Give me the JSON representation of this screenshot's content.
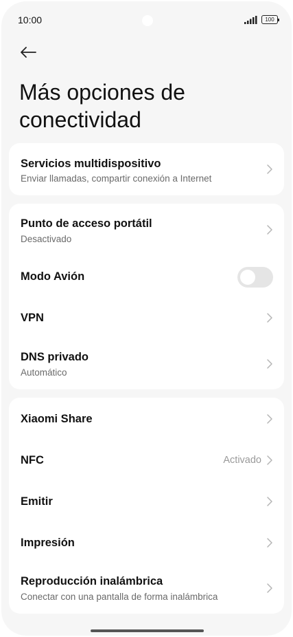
{
  "status_bar": {
    "time": "10:00",
    "battery": "100",
    "icons": [
      "signal-icon",
      "battery-icon"
    ]
  },
  "header": {
    "back_icon": "arrow-left-icon",
    "title": "Más opciones de conectividad"
  },
  "group1": {
    "items": [
      {
        "title": "Servicios multidispositivo",
        "subtitle": "Enviar llamadas, compartir conexión a Internet"
      }
    ]
  },
  "group2": {
    "items": [
      {
        "title": "Punto de acceso portátil",
        "subtitle": "Desactivado"
      },
      {
        "title": "Modo Avión",
        "toggle_on": false
      },
      {
        "title": "VPN"
      },
      {
        "title": "DNS privado",
        "subtitle": "Automático"
      }
    ]
  },
  "group3": {
    "items": [
      {
        "title": "Xiaomi Share"
      },
      {
        "title": "NFC",
        "value": "Activado"
      },
      {
        "title": "Emitir"
      },
      {
        "title": "Impresión"
      },
      {
        "title": "Reproducción inalámbrica",
        "subtitle": "Conectar con una pantalla de forma inalámbrica"
      }
    ]
  },
  "colors": {
    "background": "#f6f6f6",
    "card": "#ffffff",
    "toggle_off": "#e5e5e5"
  }
}
